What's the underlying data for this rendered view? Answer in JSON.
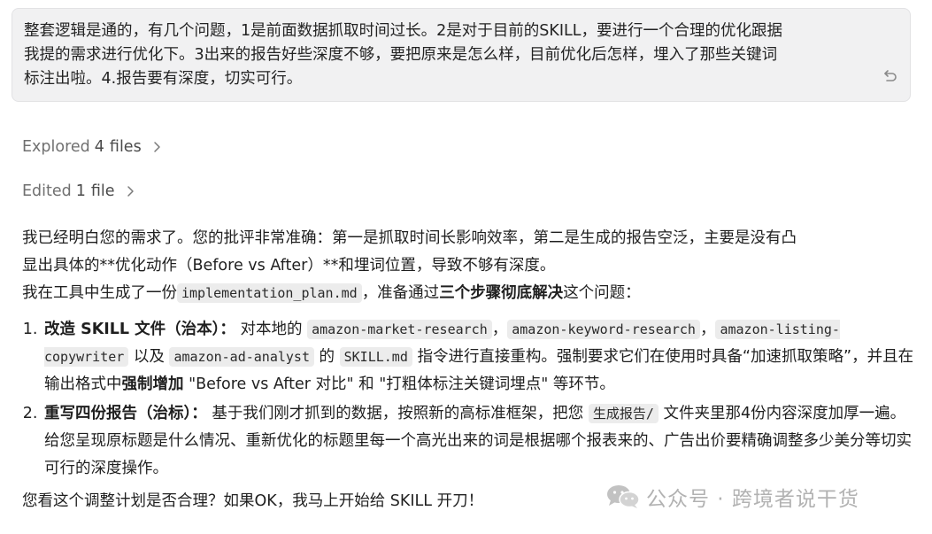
{
  "user_message": {
    "line1": "整套逻辑是通的，有几个问题，1是前面数据抓取时间过长。2是对于目前的SKILL，要进行一个合理的优化跟据",
    "line2": "我提的需求进行优化下。3出来的报告好些深度不够，要把原来是怎么样，目前优化后怎样，埋入了那些关键词",
    "line3": "标注出啦。4.报告要有深度，切实可行。"
  },
  "activity": {
    "explored": {
      "verb": "Explored",
      "count": "4",
      "noun": "files"
    },
    "edited": {
      "verb": "Edited",
      "count": "1",
      "noun": "file"
    }
  },
  "assistant": {
    "p1_line1": "我已经明白您的需求了。您的批评非常准确：第一是抓取时间长影响效率，第二是生成的报告空泛，主要是没有凸",
    "p1_line2": "显出具体的**优化动作（Before vs After）**和埋词位置，导致不够有深度。",
    "p2_pre": "我在工具中生成了一份",
    "p2_code": "implementation_plan.md",
    "p2_mid": "，准备通过",
    "p2_bold": "三个步骤彻底解决",
    "p2_post": "这个问题：",
    "item1": {
      "title": "改造 SKILL 文件（治本）：",
      "t1": " 对本地的 ",
      "c1": "amazon-market-research",
      "s1": "，",
      "c2": "amazon-keyword-research",
      "s2": "，",
      "c3": "amazon-listing-copywriter",
      "t2": " 以及 ",
      "c4": "amazon-ad-analyst",
      "t3": " 的 ",
      "c5": "SKILL.md",
      "t4": " 指令进行直接重构。强制要求它们在使用时具备“加速抓取策略”，并且在输出格式中",
      "bold": "强制增加",
      "t5": " \"Before vs After 对比\" 和 \"打粗体标注关键词埋点\" 等环节。"
    },
    "item2": {
      "title": "重写四份报告（治标）：",
      "t1": " 基于我们刚才抓到的数据，按照新的高标准框架，把您 ",
      "code": "生成报告/",
      "t2": " 文件夹里那4份内容深度加厚一遍。给您呈现原标题是什么情况、重新优化的标题里每一个高光出来的词是根据哪个报表来的、广告出价要精确调整多少美分等切实可行的深度操作。"
    },
    "closing": "您看这个调整计划是否合理？如果OK，我马上开始给 SKILL 开刀！"
  },
  "watermark": {
    "text": "公众号 · 跨境者说干货"
  },
  "icons": {
    "undo": "undo-icon",
    "chevron": "chevron-right-icon",
    "wechat": "wechat-icon"
  }
}
